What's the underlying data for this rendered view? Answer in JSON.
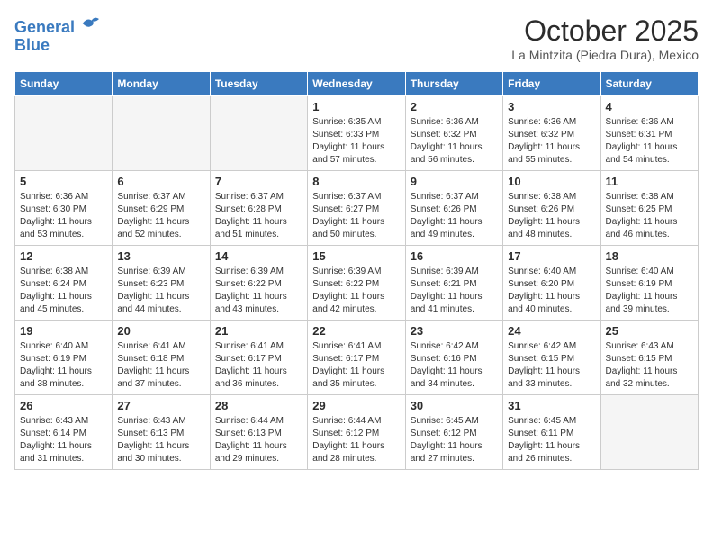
{
  "header": {
    "logo_line1": "General",
    "logo_line2": "Blue",
    "month_title": "October 2025",
    "location": "La Mintzita (Piedra Dura), Mexico"
  },
  "weekdays": [
    "Sunday",
    "Monday",
    "Tuesday",
    "Wednesday",
    "Thursday",
    "Friday",
    "Saturday"
  ],
  "weeks": [
    [
      {
        "day": "",
        "info": ""
      },
      {
        "day": "",
        "info": ""
      },
      {
        "day": "",
        "info": ""
      },
      {
        "day": "1",
        "info": "Sunrise: 6:35 AM\nSunset: 6:33 PM\nDaylight: 11 hours\nand 57 minutes."
      },
      {
        "day": "2",
        "info": "Sunrise: 6:36 AM\nSunset: 6:32 PM\nDaylight: 11 hours\nand 56 minutes."
      },
      {
        "day": "3",
        "info": "Sunrise: 6:36 AM\nSunset: 6:32 PM\nDaylight: 11 hours\nand 55 minutes."
      },
      {
        "day": "4",
        "info": "Sunrise: 6:36 AM\nSunset: 6:31 PM\nDaylight: 11 hours\nand 54 minutes."
      }
    ],
    [
      {
        "day": "5",
        "info": "Sunrise: 6:36 AM\nSunset: 6:30 PM\nDaylight: 11 hours\nand 53 minutes."
      },
      {
        "day": "6",
        "info": "Sunrise: 6:37 AM\nSunset: 6:29 PM\nDaylight: 11 hours\nand 52 minutes."
      },
      {
        "day": "7",
        "info": "Sunrise: 6:37 AM\nSunset: 6:28 PM\nDaylight: 11 hours\nand 51 minutes."
      },
      {
        "day": "8",
        "info": "Sunrise: 6:37 AM\nSunset: 6:27 PM\nDaylight: 11 hours\nand 50 minutes."
      },
      {
        "day": "9",
        "info": "Sunrise: 6:37 AM\nSunset: 6:26 PM\nDaylight: 11 hours\nand 49 minutes."
      },
      {
        "day": "10",
        "info": "Sunrise: 6:38 AM\nSunset: 6:26 PM\nDaylight: 11 hours\nand 48 minutes."
      },
      {
        "day": "11",
        "info": "Sunrise: 6:38 AM\nSunset: 6:25 PM\nDaylight: 11 hours\nand 46 minutes."
      }
    ],
    [
      {
        "day": "12",
        "info": "Sunrise: 6:38 AM\nSunset: 6:24 PM\nDaylight: 11 hours\nand 45 minutes."
      },
      {
        "day": "13",
        "info": "Sunrise: 6:39 AM\nSunset: 6:23 PM\nDaylight: 11 hours\nand 44 minutes."
      },
      {
        "day": "14",
        "info": "Sunrise: 6:39 AM\nSunset: 6:22 PM\nDaylight: 11 hours\nand 43 minutes."
      },
      {
        "day": "15",
        "info": "Sunrise: 6:39 AM\nSunset: 6:22 PM\nDaylight: 11 hours\nand 42 minutes."
      },
      {
        "day": "16",
        "info": "Sunrise: 6:39 AM\nSunset: 6:21 PM\nDaylight: 11 hours\nand 41 minutes."
      },
      {
        "day": "17",
        "info": "Sunrise: 6:40 AM\nSunset: 6:20 PM\nDaylight: 11 hours\nand 40 minutes."
      },
      {
        "day": "18",
        "info": "Sunrise: 6:40 AM\nSunset: 6:19 PM\nDaylight: 11 hours\nand 39 minutes."
      }
    ],
    [
      {
        "day": "19",
        "info": "Sunrise: 6:40 AM\nSunset: 6:19 PM\nDaylight: 11 hours\nand 38 minutes."
      },
      {
        "day": "20",
        "info": "Sunrise: 6:41 AM\nSunset: 6:18 PM\nDaylight: 11 hours\nand 37 minutes."
      },
      {
        "day": "21",
        "info": "Sunrise: 6:41 AM\nSunset: 6:17 PM\nDaylight: 11 hours\nand 36 minutes."
      },
      {
        "day": "22",
        "info": "Sunrise: 6:41 AM\nSunset: 6:17 PM\nDaylight: 11 hours\nand 35 minutes."
      },
      {
        "day": "23",
        "info": "Sunrise: 6:42 AM\nSunset: 6:16 PM\nDaylight: 11 hours\nand 34 minutes."
      },
      {
        "day": "24",
        "info": "Sunrise: 6:42 AM\nSunset: 6:15 PM\nDaylight: 11 hours\nand 33 minutes."
      },
      {
        "day": "25",
        "info": "Sunrise: 6:43 AM\nSunset: 6:15 PM\nDaylight: 11 hours\nand 32 minutes."
      }
    ],
    [
      {
        "day": "26",
        "info": "Sunrise: 6:43 AM\nSunset: 6:14 PM\nDaylight: 11 hours\nand 31 minutes."
      },
      {
        "day": "27",
        "info": "Sunrise: 6:43 AM\nSunset: 6:13 PM\nDaylight: 11 hours\nand 30 minutes."
      },
      {
        "day": "28",
        "info": "Sunrise: 6:44 AM\nSunset: 6:13 PM\nDaylight: 11 hours\nand 29 minutes."
      },
      {
        "day": "29",
        "info": "Sunrise: 6:44 AM\nSunset: 6:12 PM\nDaylight: 11 hours\nand 28 minutes."
      },
      {
        "day": "30",
        "info": "Sunrise: 6:45 AM\nSunset: 6:12 PM\nDaylight: 11 hours\nand 27 minutes."
      },
      {
        "day": "31",
        "info": "Sunrise: 6:45 AM\nSunset: 6:11 PM\nDaylight: 11 hours\nand 26 minutes."
      },
      {
        "day": "",
        "info": ""
      }
    ]
  ]
}
